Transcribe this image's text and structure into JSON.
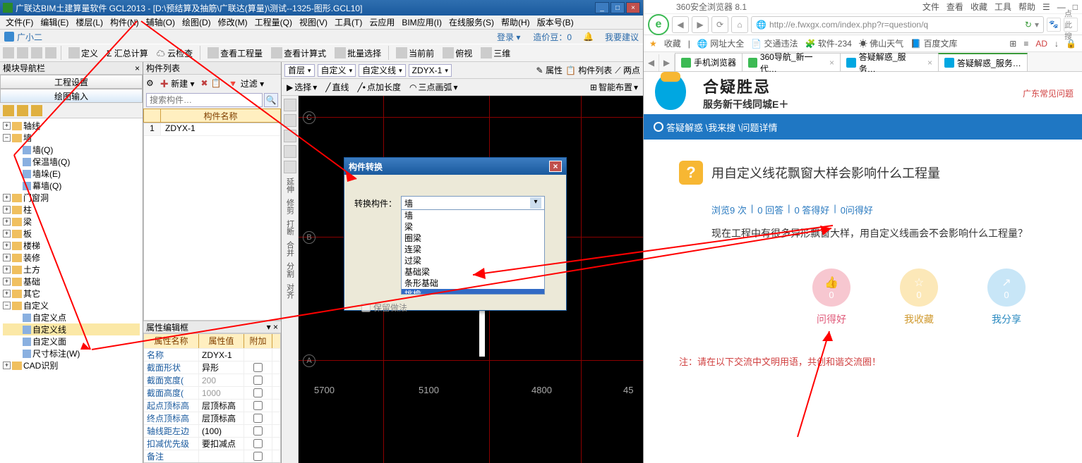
{
  "left_app": {
    "title": "广联达BIM土建算量软件 GCL2013 - [D:\\预结算及抽筋\\广联达(算量)\\测试--1325-图形.GCL10]",
    "menus": [
      "文件(F)",
      "编辑(E)",
      "楼层(L)",
      "构件(N)",
      "辅轴(O)",
      "绘图(D)",
      "修改(M)",
      "工程量(Q)",
      "视图(V)",
      "工具(T)",
      "云应用",
      "BIM应用(I)",
      "在线服务(S)",
      "帮助(H)",
      "版本号(B)"
    ],
    "assistant": "广小二",
    "topright": {
      "login": "登录 ▾",
      "price": "造价豆：0",
      "notif": "🔔",
      "feedback": "我要建议"
    },
    "toolbar1": {
      "define": "定义",
      "sumcalc": "Σ 汇总计算",
      "cloudcheck": "☁ 云检查",
      "viewqty": "查看工程量",
      "viewformula": "查看计算式",
      "batchsel": "批量选择",
      "gofront": "当前前",
      "ortho": "俯视",
      "threeD": "三维"
    },
    "nav": {
      "header": "模块导航栏",
      "btn1": "工程设置",
      "btn2": "绘图输入",
      "tree": {
        "axis": "轴线",
        "wall": "墙",
        "wall_children": [
          "墙(Q)",
          "保温墙(Q)",
          "墙垛(E)",
          "幕墙(Q)"
        ],
        "others": [
          "门窗洞",
          "柱",
          "梁",
          "板",
          "楼梯",
          "装修",
          "土方",
          "基础",
          "其它"
        ],
        "custom": "自定义",
        "custom_children": [
          "自定义点",
          "自定义线",
          "自定义面",
          "尺寸标注(W)"
        ],
        "cad": "CAD识别"
      }
    },
    "complist": {
      "header": "构件列表",
      "new": "新建",
      "filter": "过滤",
      "search_ph": "搜索构件…",
      "col": "构件名称",
      "row_idx": "1",
      "row_name": "ZDYX-1"
    },
    "propbox": {
      "header": "属性编辑框",
      "cols": [
        "属性名称",
        "属性值",
        "附加"
      ],
      "rows": [
        {
          "k": "名称",
          "v": "ZDYX-1",
          "chk": false
        },
        {
          "k": "截面形状",
          "v": "异形",
          "chk": false
        },
        {
          "k": "截面宽度(",
          "v": "200",
          "chk": false
        },
        {
          "k": "截面高度(",
          "v": "1000",
          "chk": false
        },
        {
          "k": "起点顶标高",
          "v": "层顶标高",
          "chk": false
        },
        {
          "k": "终点顶标高",
          "v": "层顶标高",
          "chk": false
        },
        {
          "k": "轴线距左边",
          "v": "(100)",
          "chk": false
        },
        {
          "k": "扣减优先级",
          "v": "要扣减点",
          "chk": false
        },
        {
          "k": "备注",
          "v": "",
          "chk": false
        }
      ]
    },
    "canvas_tb1": {
      "floor": "首层",
      "cat": "自定义",
      "sub": "自定义线",
      "item": "ZDYX-1",
      "attr": "属性",
      "list": "构件列表",
      "twopt": "两点"
    },
    "canvas_tb2": {
      "select": "选择",
      "line": "直线",
      "addlen": "点加长度",
      "arc3": "三点画弧",
      "smart": "智能布置"
    },
    "axis_labels": {
      "C": "C",
      "B": "B",
      "A": "A"
    },
    "dims": [
      "5700",
      "5100",
      "4800",
      "45"
    ],
    "dialog": {
      "title": "构件转换",
      "label": "转换构件：",
      "selected": "墙",
      "options": [
        "墙",
        "梁",
        "圈梁",
        "连梁",
        "过梁",
        "基础梁",
        "条形基础",
        "挑檐"
      ],
      "keep": "保留做法"
    }
  },
  "right_browser": {
    "appname": "360安全浏览器 8.1",
    "topmenu": [
      "文件",
      "查看",
      "收藏",
      "工具",
      "帮助"
    ],
    "url": "http://e.fwxgx.com/index.php?r=question/q",
    "url_hint": "点此搜",
    "fav": [
      "收藏",
      "网址大全",
      "交通违法",
      "软件-234",
      "佛山天气",
      "百度文库"
    ],
    "tabs": [
      "手机浏览器",
      "360导航_新一代…",
      "答疑解惑_服务…",
      "答疑解惑_服务…"
    ],
    "page": {
      "logo_title": "合疑胜忌",
      "logo_sub": "服务新干线同城E＋",
      "right_note": "广东常见问题",
      "crumb": "答疑解惑 \\我来搜 \\问题详情",
      "qtitle": "用自定义线花飘窗大样会影响什么工程量",
      "stats": [
        "浏览9 次",
        "|",
        "0 回答",
        "|",
        "0 答得好",
        "|",
        "0问得好"
      ],
      "desc": "现在工程中有很多异形飘窗大样，用自定义线画会不会影响什么工程量？",
      "actions": [
        {
          "count": "0",
          "label": "问得好",
          "cls": "pink",
          "icon": "👍"
        },
        {
          "count": "0",
          "label": "我收藏",
          "cls": "yel",
          "icon": "☆"
        },
        {
          "count": "0",
          "label": "我分享",
          "cls": "blue",
          "icon": "↗"
        }
      ],
      "foot": "注：请在以下交流中文明用语，共创和谐交流圈！"
    }
  }
}
